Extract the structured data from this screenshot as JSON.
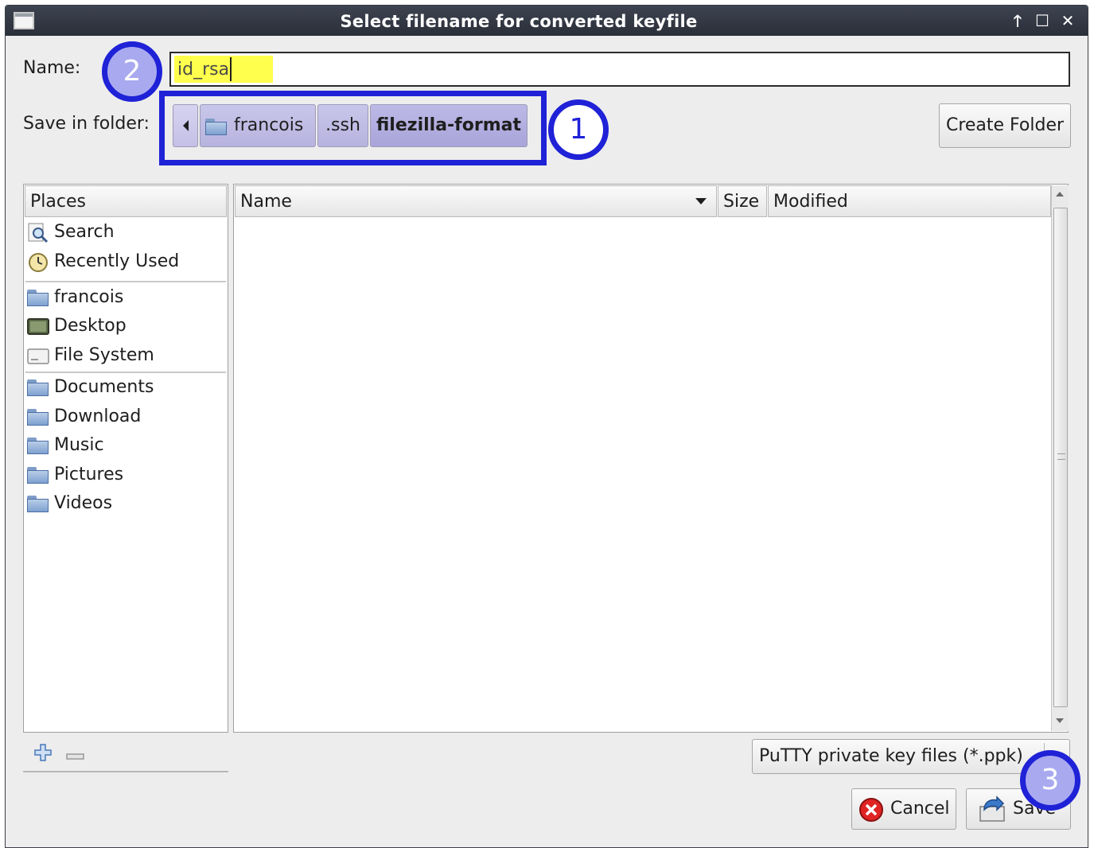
{
  "window": {
    "title": "Select filename for converted keyfile",
    "controls": {
      "up": "🡑",
      "maximize": "☐",
      "close": "✕"
    }
  },
  "name": {
    "label": "Name:",
    "value": "id_rsa"
  },
  "save_in": {
    "label": "Save in folder:",
    "path": [
      "francois",
      ".ssh",
      "filezilla-format"
    ]
  },
  "create_folder_label": "Create Folder",
  "places": {
    "header": "Places",
    "items": [
      "Search",
      "Recently Used",
      "francois",
      "Desktop",
      "File System",
      "Documents",
      "Download",
      "Music",
      "Pictures",
      "Videos"
    ]
  },
  "files": {
    "columns": [
      "Name",
      "Size",
      "Modified"
    ]
  },
  "filter": {
    "selected": "PuTTY private key files (*.ppk)"
  },
  "buttons": {
    "cancel": "Cancel",
    "save": "Save"
  },
  "annotations": [
    "1",
    "2",
    "3"
  ],
  "colors": {
    "annotation_blue": "#1f22d6",
    "highlight_yellow": "#ffff4d",
    "pathbar_active": "#b7b3df"
  }
}
